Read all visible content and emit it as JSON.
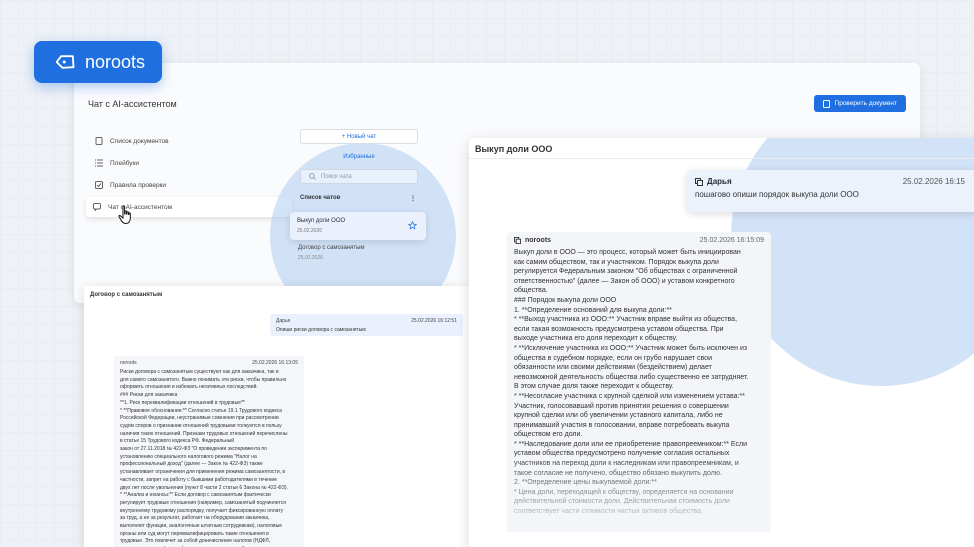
{
  "brand": {
    "name": "noroots",
    "accent": "#1f6fe0"
  },
  "app": {
    "title": "Чат с AI-ассистентом",
    "check_button": "Проверить документ",
    "sidebar": [
      {
        "label": "Список документов",
        "icon": "document-icon"
      },
      {
        "label": "Плейбуки",
        "icon": "list-icon"
      },
      {
        "label": "Правила проверки",
        "icon": "checkbox-icon"
      },
      {
        "label": "Чат с AI-ассистентом",
        "icon": "chat-icon"
      }
    ],
    "chats": {
      "new_chat": "+ Новый чат",
      "favorites": "Избранные",
      "search_placeholder": "Поиск чата",
      "list_header": "Список чатов",
      "items": [
        {
          "title": "Выкуп доли ООО",
          "date": "25.02.2026"
        },
        {
          "title": "Договор с самозанятым",
          "date": "25.02.2026"
        }
      ]
    }
  },
  "left_panel": {
    "title": "Договор с самозанятым",
    "user": {
      "name": "Дарья",
      "time": "25.02.2026 16:12:51",
      "text": "Опиши риски договора с самозанятым"
    },
    "bot": {
      "name": "noroots",
      "time": "25.02.2026 16:13:05",
      "text": "Риски договора с самозанятым существуют как для заказчика, так и\nдля самого самозанятого. Важно понимать эти риски, чтобы правильно\nоформить отношения и избежать негативных последствий.\n### Риски для заказчика\n**1. Риск переквалификации отношений в трудовые**\n* **Правовое обоснование:** Согласно статье 19.1 Трудового кодекса\nРоссийской Федерации, неустранимые сомнения при рассмотрении\nсудом споров о признании отношений трудовыми толкуются в пользу\nналичия таких отношений. Признаки трудовых отношений перечислены\nв статье 15 Трудового кодекса РФ. Федеральный\nзакон от 27.11.2018 № 422-ФЗ \"О проведении эксперимента по\nустановлению специального налогового режима \"Налог на\nпрофессиональный доход\" (далее — Закон № 422-ФЗ) также\nустанавливает ограничения для применения режима самозанятости, в\nчастности, запрет на работу с бывшими работодателями в течение\nдвух лет после увольнения (пункт 8 части 2 статьи 6 Закона № 422-ФЗ).\n* **Анализ и нюансы:** Если договор с самозанятым фактически\nрегулирует трудовые отношения (например, самозанятый подчиняется\nвнутреннему трудовому распорядку, получает фиксированную оплату\nза труд, а не за результат, работает на оборудовании заказчика,\nвыполняет функции, аналогичные штатным сотрудникам), налоговые\nорганы или суд могут переквалифицировать такие отношения в\nтрудовые. Это повлечет за собой доначисление налогов (НДФЛ,\nстраховых взносов), штрафы и пени для заказчика. Кроме того, заказчик\nбудет обязан предоставить самозанятому все гарантии,"
    }
  },
  "right_panel": {
    "title": "Выкуп доли ООО",
    "user": {
      "name": "Дарья",
      "time": "25.02.2026 16:15",
      "text": "пошагово опиши порядок выкупа доли ООО"
    },
    "bot": {
      "name": "noroots",
      "time": "25.02.2026 16:15:09",
      "text": "Выкуп доли в ООО — это процесс, который может быть инициирован\nкак самим обществом, так и участником. Порядок выкупа доли\nрегулируется Федеральным законом \"Об обществах с ограниченной\nответственностью\" (далее — Закон об ООО) и уставом конкретного\nобщества.\n### Порядок выкупа доли ООО\n1. **Определение оснований для выкупа доли:**\n* **Выход участника из ООО:** Участник вправе выйти из общества,\nесли такая возможность предусмотрена уставом общества. При\nвыходе участника его доля переходит к обществу.\n* **Исключение участника из ООО:** Участник может быть исключен из\nобщества в судебном порядке, если он грубо нарушает свои\nобязанности или своими действиями (бездействием) делает\nневозможной деятельность общества либо существенно ее затрудняет.\nВ этом случае доля также переходит к обществу.\n* **Несогласие участника с крупной сделкой или изменением устава:**\nУчастник, голосовавший против принятия решения о совершении\nкрупной сделки или об увеличении уставного капитала, либо не\nпринимавший участия в голосовании, вправе потребовать выкупа\nобществом его доли.\n* **Наследование доли или ее приобретение правопреемником:** Если\nуставом общества предусмотрено получение согласия остальных\nучастников на переход доли к наследникам или правопреемникам, и\nтакое согласие не получено, общество обязано выкупить долю.\n2. **Определение цены выкупаемой доли:**\n* Цена доли, переходящей к обществу, определяется на основании\nдействительной стоимости доли. Действительная стоимость доли\nсоответствует части стоимости чистых активов общества,"
    }
  }
}
